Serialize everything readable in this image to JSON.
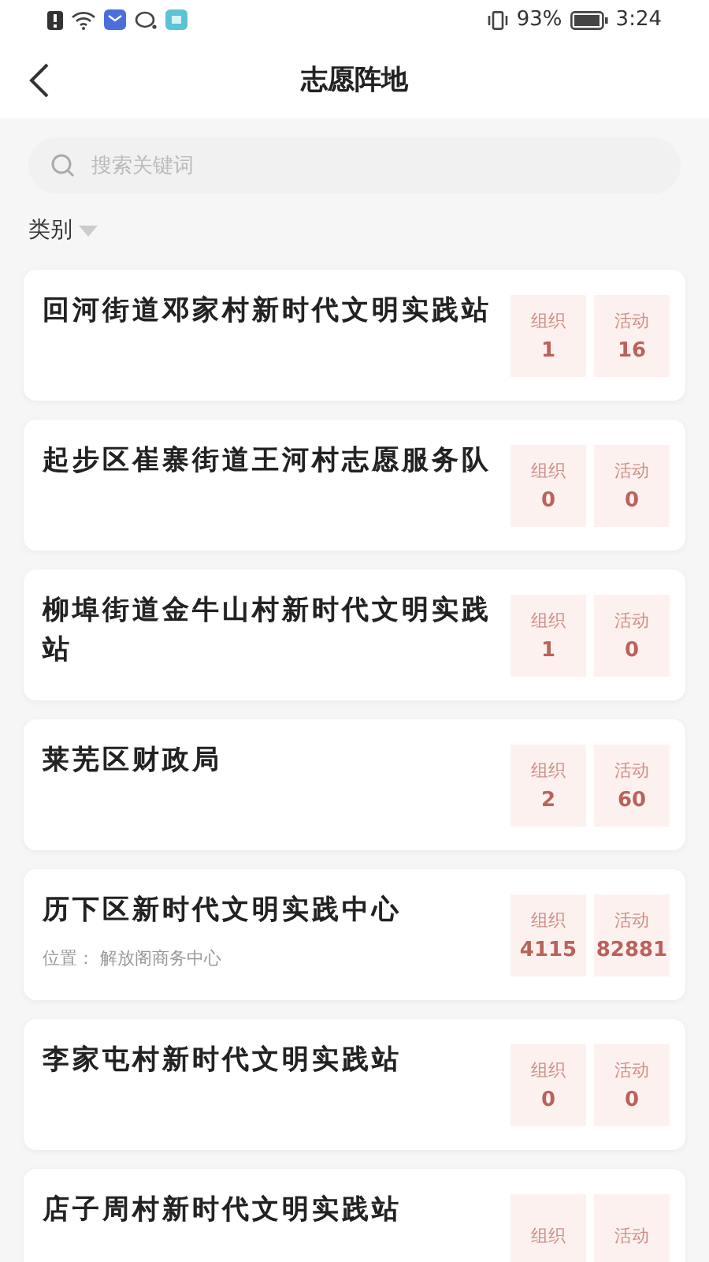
{
  "status_bar": {
    "battery_text": "93%",
    "time": "3:24"
  },
  "header": {
    "title": "志愿阵地"
  },
  "search": {
    "placeholder": "搜索关键词"
  },
  "filter": {
    "label": "类别"
  },
  "sites": [
    {
      "name": "回河街道邓家村新时代文明实践站",
      "stats": [
        {
          "label": "组织",
          "value": "1"
        },
        {
          "label": "活动",
          "value": "16"
        }
      ]
    },
    {
      "name": "起步区崔寨街道王河村志愿服务队",
      "stats": [
        {
          "label": "组织",
          "value": "0"
        },
        {
          "label": "活动",
          "value": "0"
        }
      ]
    },
    {
      "name": "柳埠街道金牛山村新时代文明实践站",
      "stats": [
        {
          "label": "组织",
          "value": "1"
        },
        {
          "label": "活动",
          "value": "0"
        }
      ]
    },
    {
      "name": "莱芜区财政局",
      "stats": [
        {
          "label": "组织",
          "value": "2"
        },
        {
          "label": "活动",
          "value": "60"
        }
      ]
    },
    {
      "name": "历下区新时代文明实践中心",
      "location": "位置：  解放阁商务中心",
      "stats": [
        {
          "label": "组织",
          "value": "4115"
        },
        {
          "label": "活动",
          "value": "82881"
        }
      ]
    },
    {
      "name": "李家屯村新时代文明实践站",
      "stats": [
        {
          "label": "组织",
          "value": "0"
        },
        {
          "label": "活动",
          "value": "0"
        }
      ]
    },
    {
      "name": "店子周村新时代文明实践站",
      "stats": [
        {
          "label": "组织"
        },
        {
          "label": "活动"
        }
      ]
    }
  ]
}
